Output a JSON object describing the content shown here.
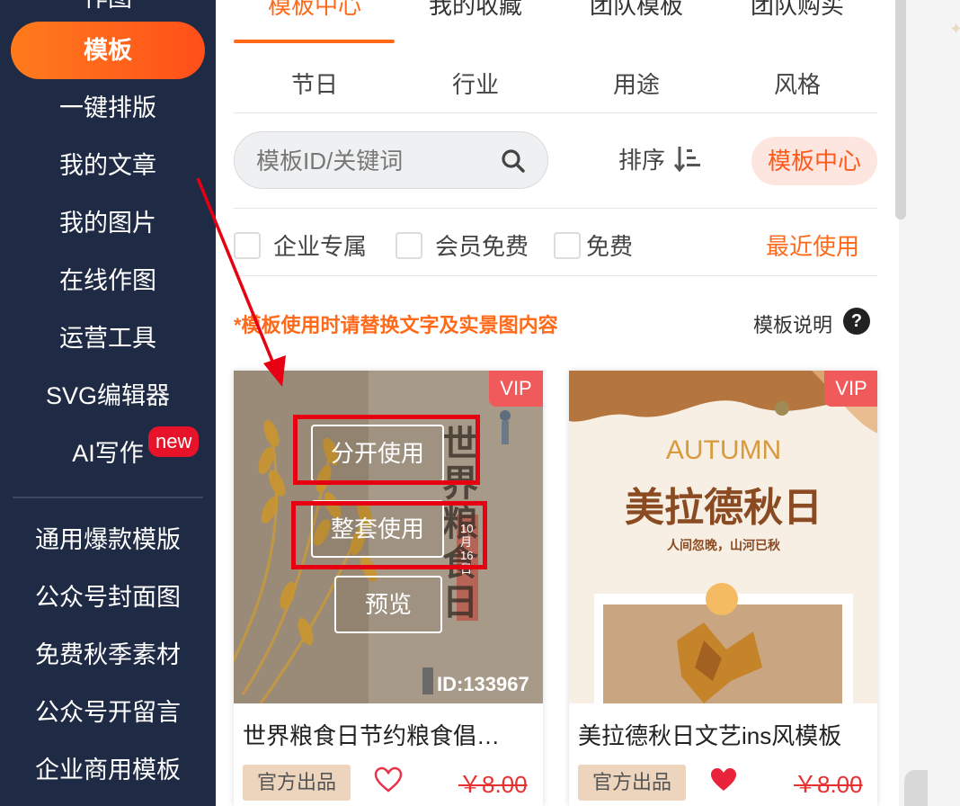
{
  "sidebar": {
    "partial_item": "作图",
    "active_item": "模板",
    "items_top": [
      "一键排版",
      "我的文章",
      "我的图片",
      "在线作图",
      "运营工具",
      "SVG编辑器",
      "AI写作"
    ],
    "new_badge": "new",
    "items_bottom": [
      "通用爆款模版",
      "公众号封面图",
      "免费秋季素材",
      "公众号开留言",
      "企业商用模板"
    ]
  },
  "tabs": {
    "top": [
      "模板中心",
      "我的收藏",
      "团队模板",
      "团队购买"
    ],
    "sub": [
      "节日",
      "行业",
      "用途",
      "风格"
    ]
  },
  "search": {
    "placeholder": "模板ID/关键词"
  },
  "sort_label": "排序",
  "center_pill": "模板中心",
  "filters": [
    "企业专属",
    "会员免费",
    "免费"
  ],
  "recent": "最近使用",
  "notice": "*模板使用时请替换文字及实景图内容",
  "explain": "模板说明",
  "explain_icon": "?",
  "cards": [
    {
      "vip": "VIP",
      "title": "世界粮食日节约粮食倡…",
      "official": "官方出品",
      "price": "￥8.00",
      "id_label": "ID:133967",
      "buttons": [
        "分开使用",
        "整套使用",
        "预览"
      ],
      "poster_title": "世界粮食日",
      "poster_date": "10月16日",
      "heart_filled": false
    },
    {
      "vip": "VIP",
      "title": "美拉德秋日文艺ins风模板",
      "official": "官方出品",
      "price": "￥8.00",
      "poster_en": "AUTUMN",
      "poster_cn": "美拉德秋日",
      "poster_sub": "人间忽晚，山河已秋",
      "heart_filled": true
    }
  ],
  "colors": {
    "accent": "#ff6a1a",
    "sidebar": "#1f2a44",
    "annotation": "#e60012"
  }
}
